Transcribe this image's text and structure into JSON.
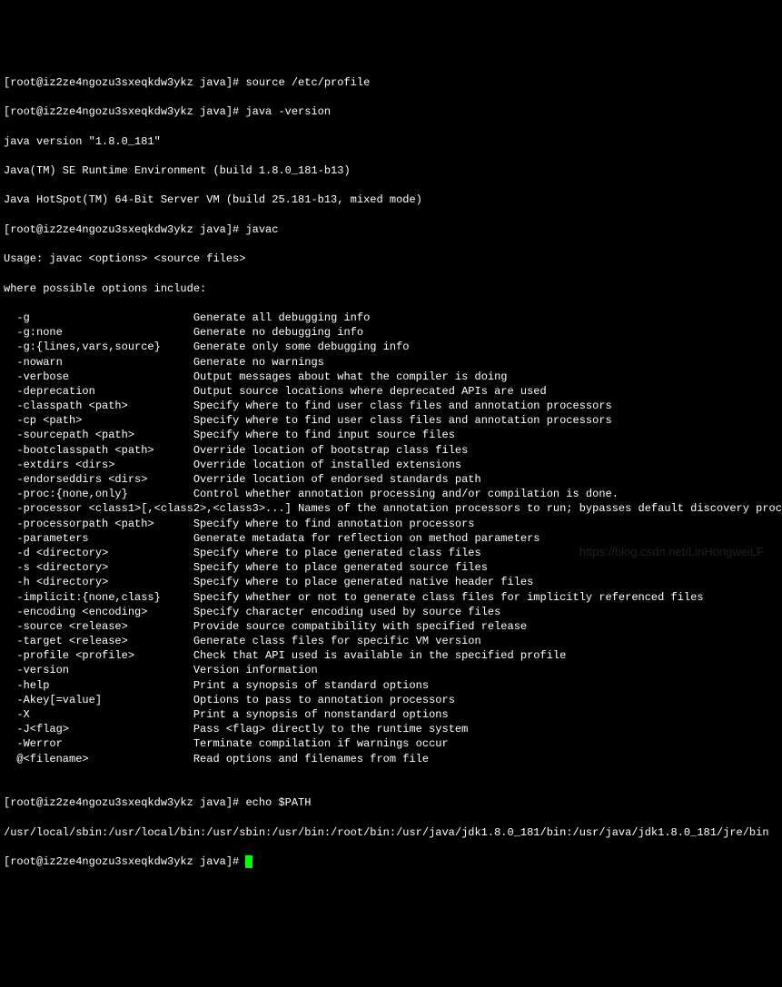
{
  "lines": {
    "l0": "[root@iz2ze4ngozu3sxeqkdw3ykz java]# source /etc/profile",
    "l1": "[root@iz2ze4ngozu3sxeqkdw3ykz java]# java -version",
    "l2": "java version \"1.8.0_181\"",
    "l3": "Java(TM) SE Runtime Environment (build 1.8.0_181-b13)",
    "l4": "Java HotSpot(TM) 64-Bit Server VM (build 25.181-b13, mixed mode)",
    "l5": "[root@iz2ze4ngozu3sxeqkdw3ykz java]# javac",
    "l6": "Usage: javac <options> <source files>",
    "l7": "where possible options include:"
  },
  "options": [
    {
      "flag": "  -g                         ",
      "desc": "Generate all debugging info"
    },
    {
      "flag": "  -g:none                    ",
      "desc": "Generate no debugging info"
    },
    {
      "flag": "  -g:{lines,vars,source}     ",
      "desc": "Generate only some debugging info"
    },
    {
      "flag": "  -nowarn                    ",
      "desc": "Generate no warnings"
    },
    {
      "flag": "  -verbose                   ",
      "desc": "Output messages about what the compiler is doing"
    },
    {
      "flag": "  -deprecation               ",
      "desc": "Output source locations where deprecated APIs are used"
    },
    {
      "flag": "  -classpath <path>          ",
      "desc": "Specify where to find user class files and annotation processors"
    },
    {
      "flag": "  -cp <path>                 ",
      "desc": "Specify where to find user class files and annotation processors"
    },
    {
      "flag": "  -sourcepath <path>         ",
      "desc": "Specify where to find input source files"
    },
    {
      "flag": "  -bootclasspath <path>      ",
      "desc": "Override location of bootstrap class files"
    },
    {
      "flag": "  -extdirs <dirs>            ",
      "desc": "Override location of installed extensions"
    },
    {
      "flag": "  -endorseddirs <dirs>       ",
      "desc": "Override location of endorsed standards path"
    },
    {
      "flag": "  -proc:{none,only}          ",
      "desc": "Control whether annotation processing and/or compilation is done."
    },
    {
      "flag": "  -processor <class1>[,<class2>,<class3>...] ",
      "desc": "Names of the annotation processors to run; bypasses default discovery process"
    },
    {
      "flag": "  -processorpath <path>      ",
      "desc": "Specify where to find annotation processors"
    },
    {
      "flag": "  -parameters                ",
      "desc": "Generate metadata for reflection on method parameters"
    },
    {
      "flag": "  -d <directory>             ",
      "desc": "Specify where to place generated class files"
    },
    {
      "flag": "  -s <directory>             ",
      "desc": "Specify where to place generated source files"
    },
    {
      "flag": "  -h <directory>             ",
      "desc": "Specify where to place generated native header files"
    },
    {
      "flag": "  -implicit:{none,class}     ",
      "desc": "Specify whether or not to generate class files for implicitly referenced files"
    },
    {
      "flag": "  -encoding <encoding>       ",
      "desc": "Specify character encoding used by source files"
    },
    {
      "flag": "  -source <release>          ",
      "desc": "Provide source compatibility with specified release"
    },
    {
      "flag": "  -target <release>          ",
      "desc": "Generate class files for specific VM version"
    },
    {
      "flag": "  -profile <profile>         ",
      "desc": "Check that API used is available in the specified profile"
    },
    {
      "flag": "  -version                   ",
      "desc": "Version information"
    },
    {
      "flag": "  -help                      ",
      "desc": "Print a synopsis of standard options"
    },
    {
      "flag": "  -Akey[=value]              ",
      "desc": "Options to pass to annotation processors"
    },
    {
      "flag": "  -X                         ",
      "desc": "Print a synopsis of nonstandard options"
    },
    {
      "flag": "  -J<flag>                   ",
      "desc": "Pass <flag> directly to the runtime system"
    },
    {
      "flag": "  -Werror                    ",
      "desc": "Terminate compilation if warnings occur"
    },
    {
      "flag": "  @<filename>                ",
      "desc": "Read options and filenames from file"
    }
  ],
  "footer": {
    "blank": "",
    "echo_cmd": "[root@iz2ze4ngozu3sxeqkdw3ykz java]# echo $PATH",
    "path_output": "/usr/local/sbin:/usr/local/bin:/usr/sbin:/usr/bin:/root/bin:/usr/java/jdk1.8.0_181/bin:/usr/java/jdk1.8.0_181/jre/bin",
    "final_prompt": "[root@iz2ze4ngozu3sxeqkdw3ykz java]# "
  },
  "watermark": "https://blog.csdn.net/LinHongweiLF"
}
